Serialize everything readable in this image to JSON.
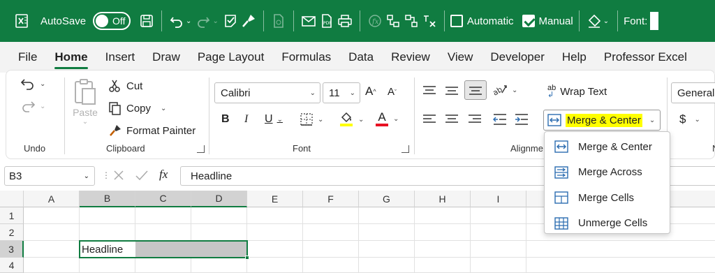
{
  "qat": {
    "autosave_label": "AutoSave",
    "autosave_state": "Off",
    "automatic_label": "Automatic",
    "manual_label": "Manual",
    "font_label": "Font:"
  },
  "tabs": [
    {
      "label": "File"
    },
    {
      "label": "Home",
      "active": true
    },
    {
      "label": "Insert"
    },
    {
      "label": "Draw"
    },
    {
      "label": "Page Layout"
    },
    {
      "label": "Formulas"
    },
    {
      "label": "Data"
    },
    {
      "label": "Review"
    },
    {
      "label": "View"
    },
    {
      "label": "Developer"
    },
    {
      "label": "Help"
    },
    {
      "label": "Professor Excel"
    }
  ],
  "ribbon": {
    "undo_group": "Undo",
    "clipboard": {
      "group": "Clipboard",
      "paste": "Paste",
      "cut": "Cut",
      "copy": "Copy",
      "format_painter": "Format Painter"
    },
    "font": {
      "group": "Font",
      "name": "Calibri",
      "size": "11",
      "bold": "B",
      "italic": "I",
      "underline": "U",
      "grow": "A",
      "shrink": "A",
      "font_color_letter": "A"
    },
    "alignment": {
      "group": "Alignme",
      "wrap_text": "Wrap Text",
      "merge_center": "Merge & Center",
      "wrap_icon": "ab"
    },
    "number": {
      "format": "General",
      "currency": "$",
      "group": "N"
    },
    "colors": {
      "brand": "#107c41",
      "highlight": "#ffff00",
      "font_red": "#e81123"
    }
  },
  "merge_menu": [
    {
      "label": "Merge & Center",
      "icon": "merge-center-icon"
    },
    {
      "label": "Merge Across",
      "icon": "merge-across-icon"
    },
    {
      "label": "Merge Cells",
      "icon": "merge-cells-icon"
    },
    {
      "label": "Unmerge Cells",
      "icon": "unmerge-cells-icon"
    }
  ],
  "formula_bar": {
    "name_box": "B3",
    "fx": "fx",
    "content": "Headline"
  },
  "grid": {
    "columns": [
      "A",
      "B",
      "C",
      "D",
      "E",
      "F",
      "G",
      "H",
      "I"
    ],
    "rows": [
      "1",
      "2",
      "3",
      "4"
    ],
    "selected_columns": [
      "B",
      "C",
      "D"
    ],
    "selected_row": "3",
    "cell_b3": "Headline"
  }
}
